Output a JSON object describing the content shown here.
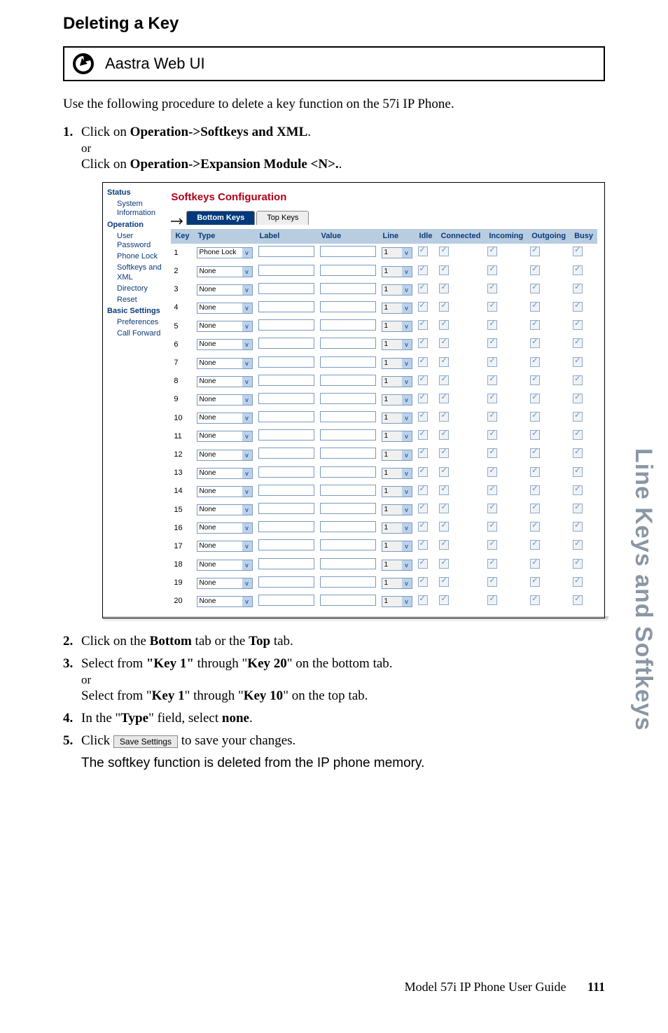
{
  "heading": "Deleting a Key",
  "webui_title": "Aastra Web UI",
  "intro": "Use the following procedure to delete a key function on the 57i IP Phone.",
  "steps": {
    "s1": {
      "num": "1.",
      "a_prefix": "Click on ",
      "a_bold": "Operation->Softkeys and XML",
      "a_suffix": ".",
      "or": "or",
      "b_prefix": "Click on ",
      "b_bold": "Operation->Expansion Module <N>.",
      "b_suffix": "."
    },
    "s2": {
      "num": "2.",
      "p1": "Click on the ",
      "b1": "Bottom",
      "p2": " tab or the ",
      "b2": "Top",
      "p3": " tab."
    },
    "s3": {
      "num": "3.",
      "p1": "Select from ",
      "b1": "\"Key 1\"",
      "p2": " through \"",
      "b2": "Key 20",
      "p3": "\" on the bottom tab.",
      "or": "or",
      "p4": "Select from \"",
      "b3": "Key 1",
      "p5": "\" through \"",
      "b4": "Key 10",
      "p6": "\" on the top tab."
    },
    "s4": {
      "num": "4.",
      "p1": "In the \"",
      "b1": "Type",
      "p2": "\" field, select ",
      "b2": "none",
      "p3": "."
    },
    "s5": {
      "num": "5.",
      "p1": "Click ",
      "btn": "Save Settings",
      "p2": " to save your changes."
    }
  },
  "result": "The softkey function is deleted from the IP phone memory.",
  "screenshot": {
    "title": "Softkeys Configuration",
    "nav": {
      "status": "Status",
      "status_items": [
        "System Information"
      ],
      "operation": "Operation",
      "operation_items": [
        "User Password",
        "Phone Lock",
        "Softkeys and XML",
        "Directory",
        "Reset"
      ],
      "basic": "Basic Settings",
      "basic_items": [
        "Preferences",
        "Call Forward"
      ]
    },
    "tabs": {
      "bottom": "Bottom Keys",
      "top": "Top Keys"
    },
    "columns": [
      "Key",
      "Type",
      "Label",
      "Value",
      "Line",
      "Idle",
      "Connected",
      "Incoming",
      "Outgoing",
      "Busy"
    ],
    "rows": [
      {
        "key": "1",
        "type": "Phone Lock",
        "line": "1"
      },
      {
        "key": "2",
        "type": "None",
        "line": "1"
      },
      {
        "key": "3",
        "type": "None",
        "line": "1"
      },
      {
        "key": "4",
        "type": "None",
        "line": "1"
      },
      {
        "key": "5",
        "type": "None",
        "line": "1"
      },
      {
        "key": "6",
        "type": "None",
        "line": "1"
      },
      {
        "key": "7",
        "type": "None",
        "line": "1"
      },
      {
        "key": "8",
        "type": "None",
        "line": "1"
      },
      {
        "key": "9",
        "type": "None",
        "line": "1"
      },
      {
        "key": "10",
        "type": "None",
        "line": "1"
      },
      {
        "key": "11",
        "type": "None",
        "line": "1"
      },
      {
        "key": "12",
        "type": "None",
        "line": "1"
      },
      {
        "key": "13",
        "type": "None",
        "line": "1"
      },
      {
        "key": "14",
        "type": "None",
        "line": "1"
      },
      {
        "key": "15",
        "type": "None",
        "line": "1"
      },
      {
        "key": "16",
        "type": "None",
        "line": "1"
      },
      {
        "key": "17",
        "type": "None",
        "line": "1"
      },
      {
        "key": "18",
        "type": "None",
        "line": "1"
      },
      {
        "key": "19",
        "type": "None",
        "line": "1"
      },
      {
        "key": "20",
        "type": "None",
        "line": "1"
      }
    ]
  },
  "side_tab": "Line Keys and Softkeys",
  "footer": {
    "text": "Model 57i IP Phone User Guide",
    "page": "111"
  }
}
